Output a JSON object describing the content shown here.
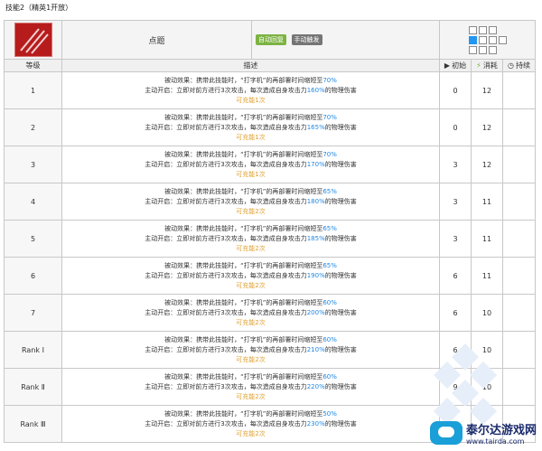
{
  "page": {
    "title": "技能2（精英1开放）"
  },
  "skill": {
    "name": "点题",
    "tags": [
      "自动回复",
      "手动触发"
    ]
  },
  "headers": {
    "level": "等级",
    "desc": "描述",
    "initial": "初始",
    "cost": "消耗",
    "duration": "持续"
  },
  "levels": [
    {
      "level": "1",
      "line1_pre": "被动效果：携带此技能时，“打字机”的再部署时间缩短至",
      "line1_val": "70%",
      "line2_pre": "主动开启：立即对前方进行3次攻击，每次造成自身攻击力",
      "line2_val": "160%",
      "line2_post": "的物理伤害",
      "charge": "可充能1次",
      "initial": "0",
      "cost": "12"
    },
    {
      "level": "2",
      "line1_pre": "被动效果：携带此技能时，“打字机”的再部署时间缩短至",
      "line1_val": "70%",
      "line2_pre": "主动开启：立即对前方进行3次攻击，每次造成自身攻击力",
      "line2_val": "165%",
      "line2_post": "的物理伤害",
      "charge": "可充能1次",
      "initial": "0",
      "cost": "12"
    },
    {
      "level": "3",
      "line1_pre": "被动效果：携带此技能时，“打字机”的再部署时间缩短至",
      "line1_val": "70%",
      "line2_pre": "主动开启：立即对前方进行3次攻击，每次造成自身攻击力",
      "line2_val": "170%",
      "line2_post": "的物理伤害",
      "charge": "可充能1次",
      "initial": "3",
      "cost": "12"
    },
    {
      "level": "4",
      "line1_pre": "被动效果：携带此技能时，“打字机”的再部署时间缩短至",
      "line1_val": "65%",
      "line2_pre": "主动开启：立即对前方进行3次攻击，每次造成自身攻击力",
      "line2_val": "180%",
      "line2_post": "的物理伤害",
      "charge": "可充能2次",
      "initial": "3",
      "cost": "11"
    },
    {
      "level": "5",
      "line1_pre": "被动效果：携带此技能时，“打字机”的再部署时间缩短至",
      "line1_val": "65%",
      "line2_pre": "主动开启：立即对前方进行3次攻击，每次造成自身攻击力",
      "line2_val": "185%",
      "line2_post": "的物理伤害",
      "charge": "可充能2次",
      "initial": "3",
      "cost": "11"
    },
    {
      "level": "6",
      "line1_pre": "被动效果：携带此技能时，“打字机”的再部署时间缩短至",
      "line1_val": "65%",
      "line2_pre": "主动开启：立即对前方进行3次攻击，每次造成自身攻击力",
      "line2_val": "190%",
      "line2_post": "的物理伤害",
      "charge": "可充能2次",
      "initial": "6",
      "cost": "11"
    },
    {
      "level": "7",
      "line1_pre": "被动效果：携带此技能时，“打字机”的再部署时间缩短至",
      "line1_val": "60%",
      "line2_pre": "主动开启：立即对前方进行3次攻击，每次造成自身攻击力",
      "line2_val": "200%",
      "line2_post": "的物理伤害",
      "charge": "可充能2次",
      "initial": "6",
      "cost": "10"
    },
    {
      "level": "Rank Ⅰ",
      "line1_pre": "被动效果：携带此技能时，“打字机”的再部署时间缩短至",
      "line1_val": "60%",
      "line2_pre": "主动开启：立即对前方进行3次攻击，每次造成自身攻击力",
      "line2_val": "210%",
      "line2_post": "的物理伤害",
      "charge": "可充能2次",
      "initial": "6",
      "cost": "10"
    },
    {
      "level": "Rank Ⅱ",
      "line1_pre": "被动效果：携带此技能时，“打字机”的再部署时间缩短至",
      "line1_val": "60%",
      "line2_pre": "主动开启：立即对前方进行3次攻击，每次造成自身攻击力",
      "line2_val": "220%",
      "line2_post": "的物理伤害",
      "charge": "可充能2次",
      "initial": "9",
      "cost": "10"
    },
    {
      "level": "Rank Ⅲ",
      "line1_pre": "被动效果：携带此技能时，“打字机”的再部署时间缩短至",
      "line1_val": "50%",
      "line2_pre": "主动开启：立即对前方进行3次攻击，每次造成自身攻击力",
      "line2_val": "230%",
      "line2_post": "的物理伤害",
      "charge": "可充能2次",
      "initial": "",
      "cost": ""
    }
  ],
  "watermark": {
    "title": "泰尔达游戏网",
    "url": "www.tairda.com"
  },
  "colors": {
    "highlight": "#1e88e5",
    "charge": "#e0a030",
    "tag_auto": "#7cb342",
    "tag_manual": "#757575",
    "range_self": "#2196f3"
  }
}
